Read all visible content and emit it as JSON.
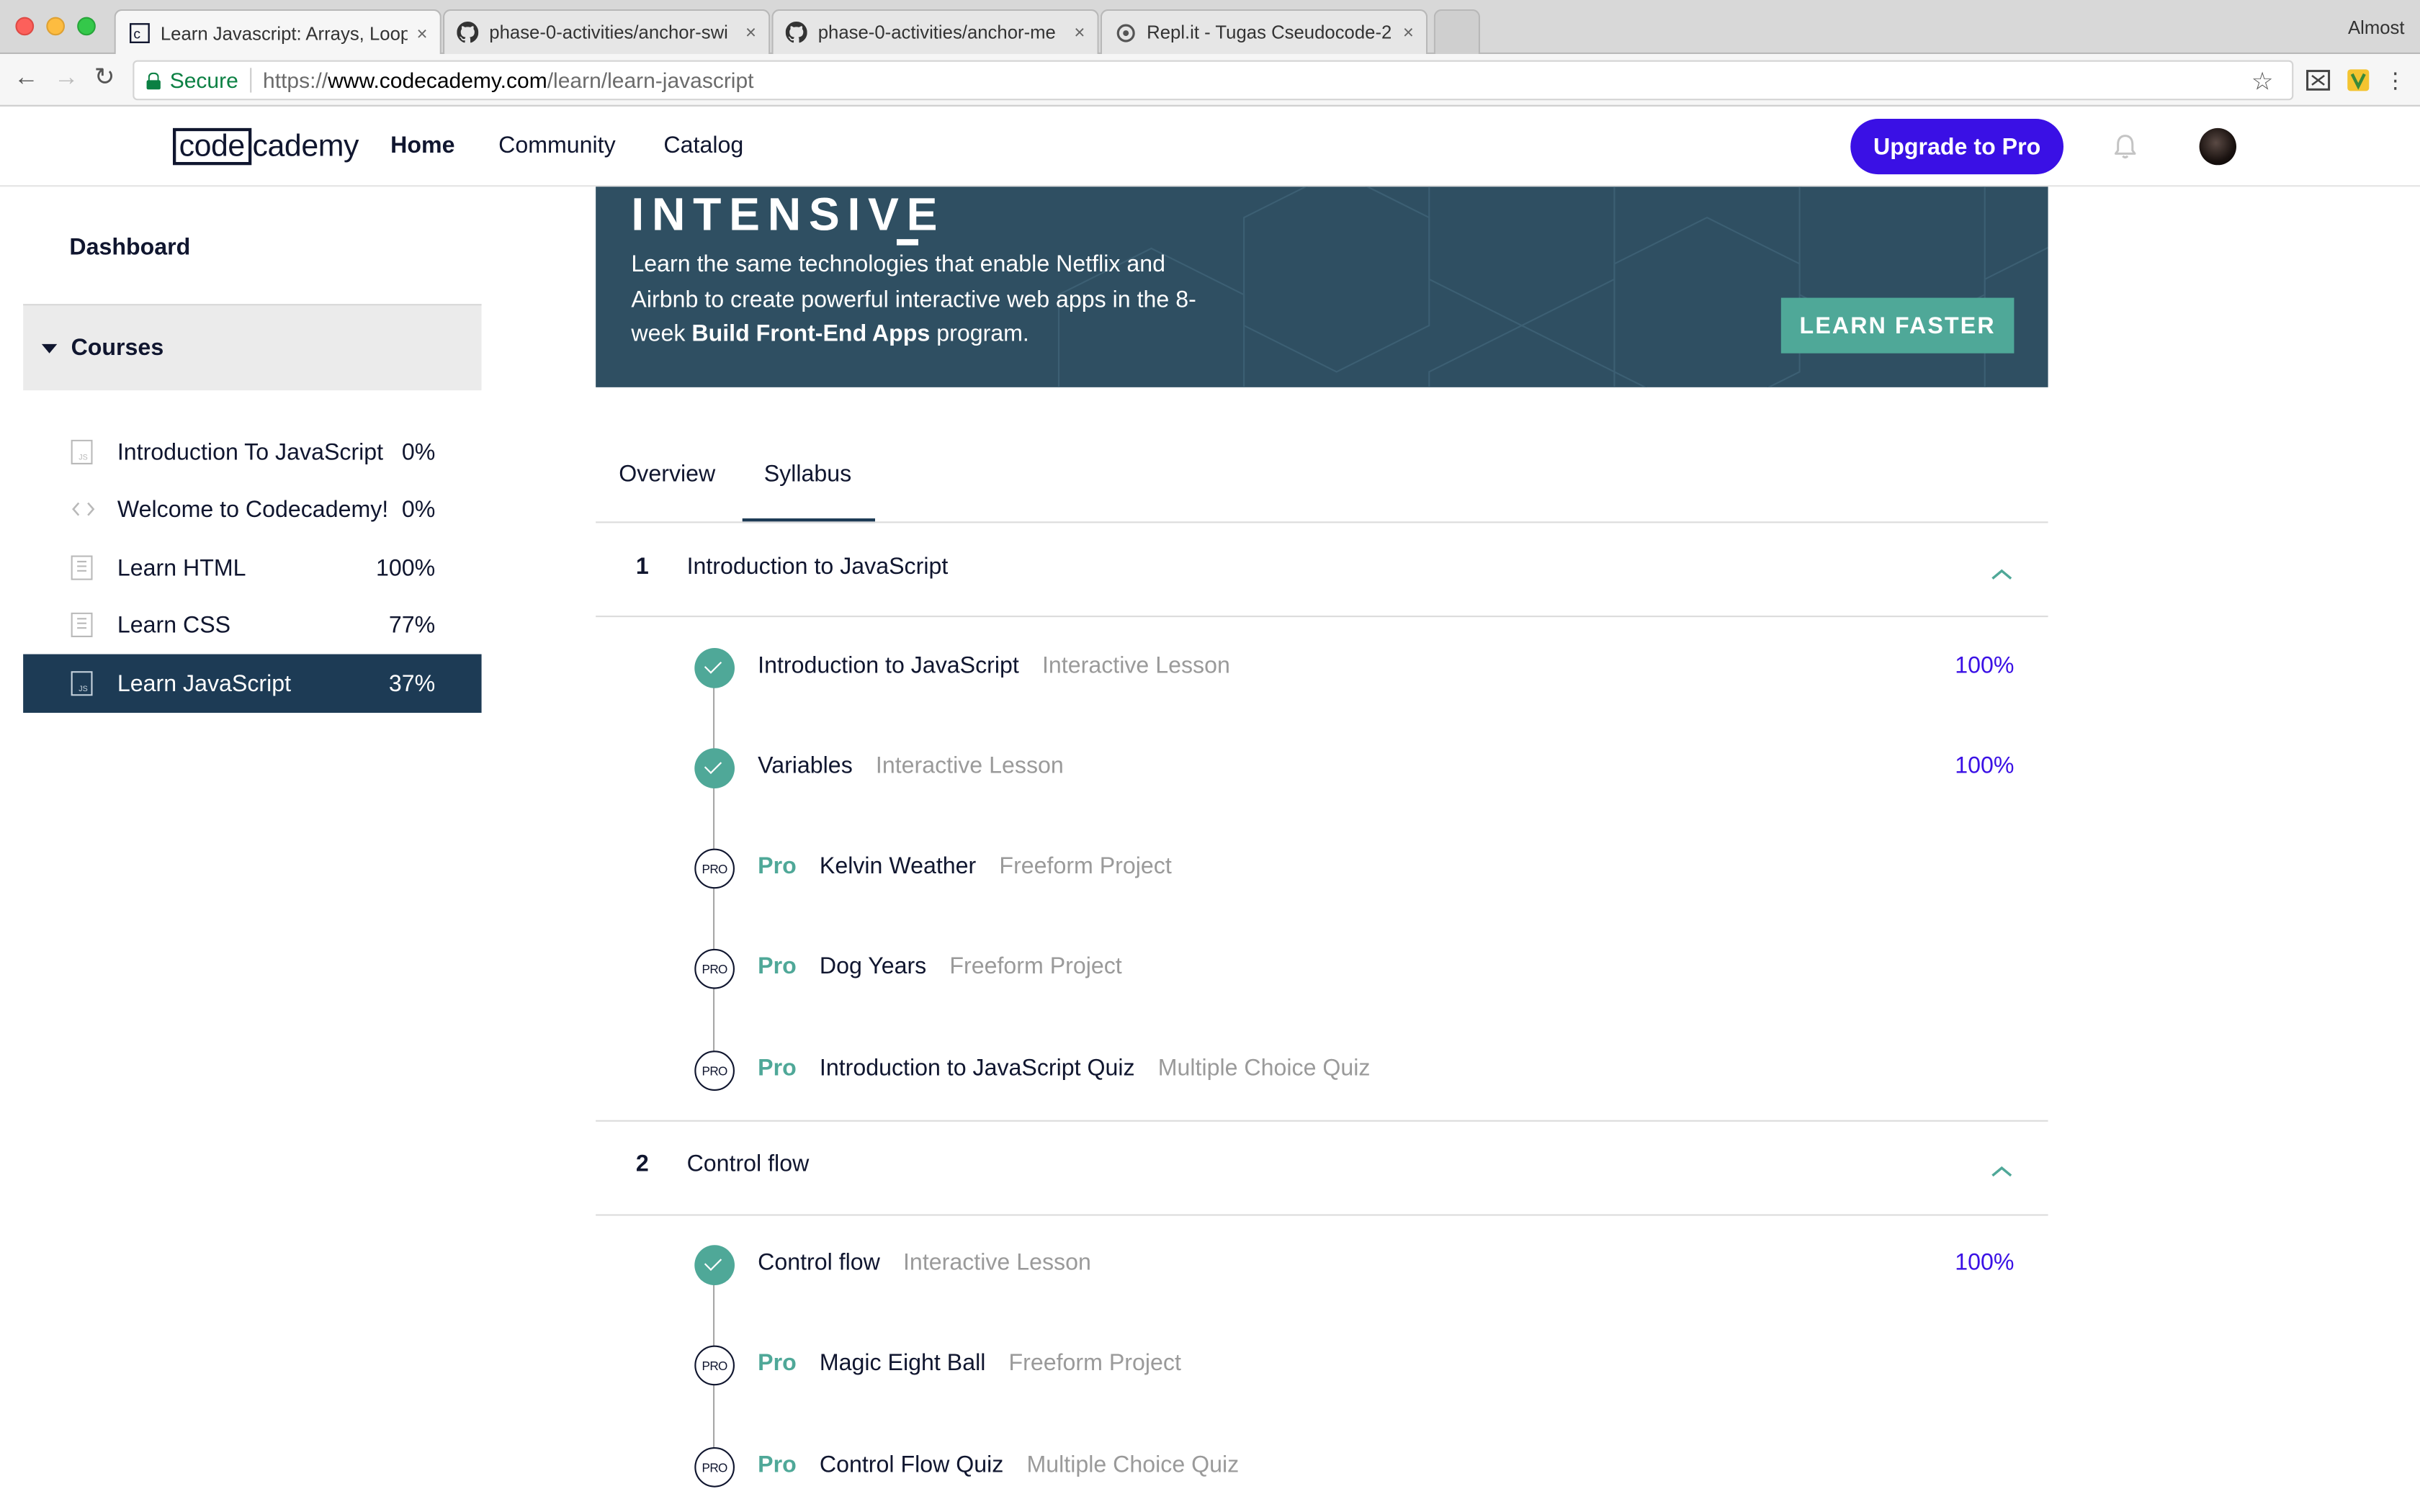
{
  "browser": {
    "tabs": [
      {
        "title": "Learn Javascript: Arrays, Loops",
        "active": true,
        "icon": "codecademy-favicon"
      },
      {
        "title": "phase-0-activities/anchor-swi",
        "active": false,
        "icon": "github-icon"
      },
      {
        "title": "phase-0-activities/anchor-me",
        "active": false,
        "icon": "github-icon"
      },
      {
        "title": "Repl.it - Tugas Cseudocode-2",
        "active": false,
        "icon": "replit-icon"
      }
    ],
    "tab_close": "×",
    "window_user": "Almost",
    "secure_label": "Secure",
    "url_proto": "https://",
    "url_host": "www.codecademy.com",
    "url_path": "/learn/learn-javascript"
  },
  "header": {
    "logo_box": "code",
    "logo_rest": "cademy",
    "nav": [
      "Home",
      "Community",
      "Catalog"
    ],
    "upgrade_label": "Upgrade to Pro"
  },
  "sidebar": {
    "dashboard": "Dashboard",
    "courses_label": "Courses",
    "courses": [
      {
        "name": "Introduction To JavaScript",
        "pct": "0%",
        "icon": "js-file-icon",
        "active": false
      },
      {
        "name": "Welcome to Codecademy!",
        "pct": "0%",
        "icon": "code-brackets-icon",
        "active": false
      },
      {
        "name": "Learn HTML",
        "pct": "100%",
        "icon": "html-file-icon",
        "active": false
      },
      {
        "name": "Learn CSS",
        "pct": "77%",
        "icon": "css-file-icon",
        "active": false
      },
      {
        "name": "Learn JavaScript",
        "pct": "37%",
        "icon": "js-file-icon",
        "active": true
      }
    ]
  },
  "banner": {
    "title": "INTENSIVE",
    "text_pre": "Learn the same technologies that enable Netflix and Airbnb to create powerful interactive web apps in the 8-week ",
    "text_bold": "Build Front-End Apps",
    "text_post": " program.",
    "cta": "LEARN FASTER"
  },
  "course_tabs": {
    "overview": "Overview",
    "syllabus": "Syllabus",
    "active": "Syllabus"
  },
  "syllabus": [
    {
      "num": "1",
      "title": "Introduction to JavaScript",
      "items": [
        {
          "pro": false,
          "done": true,
          "name": "Introduction to JavaScript",
          "type": "Interactive Lesson",
          "pct": "100%"
        },
        {
          "pro": false,
          "done": true,
          "name": "Variables",
          "type": "Interactive Lesson",
          "pct": "100%"
        },
        {
          "pro": true,
          "done": false,
          "name": "Kelvin Weather",
          "type": "Freeform Project",
          "pct": ""
        },
        {
          "pro": true,
          "done": false,
          "name": "Dog Years",
          "type": "Freeform Project",
          "pct": ""
        },
        {
          "pro": true,
          "done": false,
          "name": "Introduction to JavaScript Quiz",
          "type": "Multiple Choice Quiz",
          "pct": ""
        }
      ]
    },
    {
      "num": "2",
      "title": "Control flow",
      "items": [
        {
          "pro": false,
          "done": true,
          "name": "Control flow",
          "type": "Interactive Lesson",
          "pct": "100%"
        },
        {
          "pro": true,
          "done": false,
          "name": "Magic Eight Ball",
          "type": "Freeform Project",
          "pct": ""
        },
        {
          "pro": true,
          "done": false,
          "name": "Control Flow Quiz",
          "type": "Multiple Choice Quiz",
          "pct": ""
        }
      ]
    }
  ],
  "labels": {
    "pro_tag": "Pro",
    "pro_badge": "PRO"
  },
  "colors": {
    "brand_blue": "#3a10e5",
    "teal": "#4fa898",
    "navy": "#10162f",
    "active_course_bg": "#1d3b55",
    "banner_bg": "#2f4f62"
  }
}
